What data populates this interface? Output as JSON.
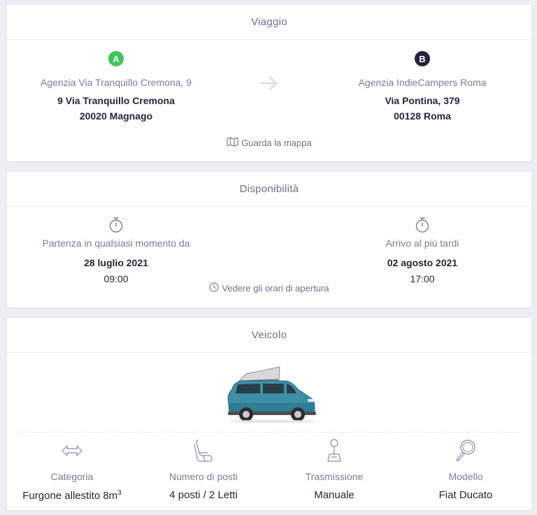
{
  "trip": {
    "title": "Viaggio",
    "from": {
      "badge": "A",
      "badge_color": "#3fc45a",
      "name": "Agenzia Via Tranquillo Cremona, 9",
      "address_line1": "9 Via Tranquillo Cremona",
      "address_line2": "20020 Magnago"
    },
    "to": {
      "badge": "B",
      "badge_color": "#23243a",
      "name": "Agenzia IndieCampers Roma",
      "address_line1": "Via Pontina, 379",
      "address_line2": "00128 Roma"
    },
    "arrow_icon": "arrow-right-icon",
    "map_icon": "map-icon",
    "map_link": "Guarda la mappa"
  },
  "availability": {
    "title": "Disponibilità",
    "start": {
      "icon": "stopwatch-icon",
      "label": "Partenza in qualsiasi momento da",
      "date": "28 luglio 2021",
      "time": "09:00"
    },
    "end": {
      "icon": "stopwatch-icon",
      "label": "Arrivo al più tardi",
      "date": "02 agosto 2021",
      "time": "17:00"
    },
    "hours_icon": "clock-icon",
    "hours_link": "Vedere gli orari di apertura"
  },
  "vehicle": {
    "title": "Veicolo",
    "image": "camper-van-image",
    "specs": [
      {
        "icon": "size-arrows-icon",
        "label": "Categoria",
        "value": "Furgone allestito 8m",
        "value_sup": "3"
      },
      {
        "icon": "seat-icon",
        "label": "Numero di posti",
        "value": "4 posti / 2 Letti"
      },
      {
        "icon": "gear-shift-icon",
        "label": "Trasmissione",
        "value": "Manuale"
      },
      {
        "icon": "magnifier-icon",
        "label": "Modello",
        "value": "Fiat Ducato"
      }
    ]
  },
  "colors": {
    "background": "#eceef3",
    "card": "#ffffff",
    "muted_text": "#7a7c98",
    "dark_text": "#24263b",
    "icon_stroke": "#8a8ca6"
  }
}
